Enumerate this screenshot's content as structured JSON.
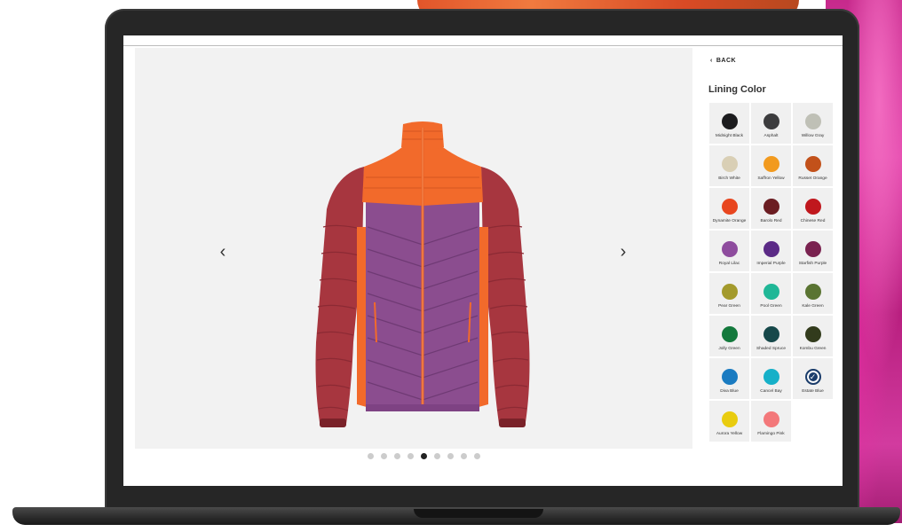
{
  "panel": {
    "back_label": "BACK",
    "title": "Lining Color"
  },
  "viewer": {
    "prev_icon": "chevron-left-icon",
    "next_icon": "chevron-right-icon",
    "prev_glyph": "‹",
    "next_glyph": "›",
    "image_count": 9,
    "active_index": 4
  },
  "swatches": [
    {
      "name": "Midnight Black",
      "color": "#1c1c1e"
    },
    {
      "name": "Asphalt",
      "color": "#3c3c3e"
    },
    {
      "name": "Willow Gray",
      "color": "#bfc0b6"
    },
    {
      "name": "Birch White",
      "color": "#d9cfb5"
    },
    {
      "name": "Saffron Yellow",
      "color": "#f29a1e"
    },
    {
      "name": "Russet Orange",
      "color": "#c2511a"
    },
    {
      "name": "Dynamite Orange",
      "color": "#e8461f"
    },
    {
      "name": "Barolo Red",
      "color": "#6b1d22"
    },
    {
      "name": "Chinese Red",
      "color": "#c0171d"
    },
    {
      "name": "Royal Lilac",
      "color": "#8e4c9e"
    },
    {
      "name": "Imperial Purple",
      "color": "#5b2a86"
    },
    {
      "name": "Starfish Purple",
      "color": "#7a2250"
    },
    {
      "name": "Pear Green",
      "color": "#a39a2c"
    },
    {
      "name": "Pool Green",
      "color": "#20b797"
    },
    {
      "name": "Kale Green",
      "color": "#5a7432"
    },
    {
      "name": "Jolly Green",
      "color": "#13793c"
    },
    {
      "name": "Shaded Spruce",
      "color": "#16484a"
    },
    {
      "name": "Kombu Green",
      "color": "#323b1c"
    },
    {
      "name": "Diva Blue",
      "color": "#1a7bc1"
    },
    {
      "name": "Cancel Bay",
      "color": "#16b0c8"
    },
    {
      "name": "Estate Blue",
      "color": "#1b3d6b",
      "selected": true
    },
    {
      "name": "Aurora Yellow",
      "color": "#e9cc0f"
    },
    {
      "name": "Flamingo Pink",
      "color": "#f3787a"
    }
  ],
  "colors": {
    "laptop_frame": "#262626",
    "viewer_bg": "#f2f2f2",
    "swatch_bg": "#f0f0f0",
    "jacket_body": "#8b4d8f",
    "jacket_sleeves": "#a7363f",
    "jacket_accent": "#f26a2b"
  }
}
